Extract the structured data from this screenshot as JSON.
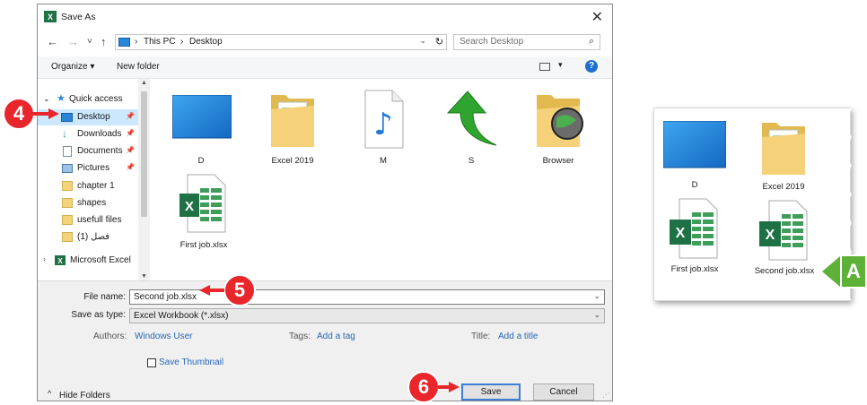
{
  "dialog": {
    "title": "Save As",
    "close": "✕"
  },
  "nav": {
    "back": "←",
    "forward": "→",
    "recent": "˅",
    "up": "↑",
    "breadcrumbs": [
      "This PC",
      "Desktop"
    ],
    "separator": "›",
    "search_placeholder": "Search Desktop"
  },
  "toolbar": {
    "organize": "Organize ▾",
    "new_folder": "New folder",
    "help": "?"
  },
  "sidebar": {
    "items": [
      {
        "label": "Quick access"
      },
      {
        "label": "Desktop"
      },
      {
        "label": "Downloads"
      },
      {
        "label": "Documents"
      },
      {
        "label": "Pictures"
      },
      {
        "label": "chapter 1"
      },
      {
        "label": "shapes"
      },
      {
        "label": "usefull files"
      },
      {
        "label": "فصل (1)"
      },
      {
        "label": "Microsoft Excel"
      }
    ]
  },
  "files": [
    {
      "name": "D"
    },
    {
      "name": "Excel 2019"
    },
    {
      "name": "M"
    },
    {
      "name": "S"
    },
    {
      "name": "Browser"
    },
    {
      "name": "First job.xlsx"
    }
  ],
  "form": {
    "file_name_label": "File name:",
    "file_name_value": "Second job.xlsx",
    "save_as_type_label": "Save as type:",
    "save_as_type_value": "Excel Workbook (*.xlsx)",
    "authors_label": "Authors:",
    "authors_value": "Windows User",
    "tags_label": "Tags:",
    "tags_value": "Add a tag",
    "title_label": "Title:",
    "title_value": "Add a title",
    "save_thumbnail": "Save Thumbnail",
    "hide_folders": "Hide Folders",
    "save": "Save",
    "cancel": "Cancel"
  },
  "steps": {
    "four": "4",
    "five": "5",
    "six": "6",
    "a": "A"
  },
  "callout": {
    "files": [
      {
        "name": "D"
      },
      {
        "name": "Excel 2019"
      },
      {
        "name": "First job.xlsx"
      },
      {
        "name": "Second job.xlsx"
      }
    ]
  },
  "colors": {
    "step_badge": "#e8262b",
    "callout_badge": "#5db136",
    "selection": "#cce8ff",
    "link": "#2666b8"
  }
}
